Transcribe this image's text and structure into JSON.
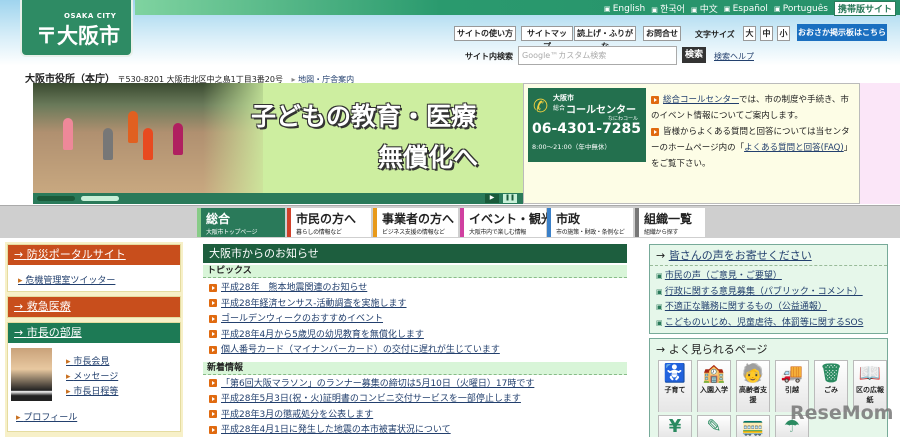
{
  "header": {
    "logo_en": "OSAKA CITY",
    "logo_jp": "大阪市",
    "languages": [
      "English",
      "한국어",
      "中文",
      "Español",
      "Português"
    ],
    "mobile": "携帯版サイト",
    "tools": [
      "サイトの使い方",
      "サイトマップ",
      "読上げ・ふりがな",
      "お問合せ"
    ],
    "font_size_label": "文字サイズ",
    "font_sizes": [
      "大",
      "中",
      "小"
    ],
    "bbs": "おおさか掲示板はこちら",
    "search_label": "サイト内検索",
    "search_placeholder": "Google™カスタム検索",
    "search_button": "検索",
    "search_help": "検索ヘルプ",
    "office": "大阪市役所（本庁）",
    "address": "〒530-8201 大阪市北区中之島1丁目3番20号",
    "map_link": "地図・庁舎案内"
  },
  "banner": {
    "line1": "子どもの教育・医療",
    "line2": "無償化へ"
  },
  "call_center": {
    "city": "大阪市",
    "name_prefix": "総合",
    "name": "コールセンター",
    "nickname": "なにわコール",
    "phone": "06-4301-7285",
    "hours": "8:00～21:00（年中無休）",
    "text1_link": "総合コールセンター",
    "text1": "では、市の制度や手続き、市のイベント情報についてご案内します。",
    "text2a": "皆様からよくある質問と回答については当センターのホームページ内の「",
    "text2_link": "よくある質問と回答(FAQ)",
    "text2b": "」をご覧下さい。"
  },
  "nav": [
    {
      "title": "総合",
      "sub": "大阪市トップページ",
      "color": "#2a7a5a"
    },
    {
      "title": "市民の方へ",
      "sub": "暮らしの情報など",
      "color": "#d0402a"
    },
    {
      "title": "事業者の方へ",
      "sub": "ビジネス支援の情報など",
      "color": "#e89a1a"
    },
    {
      "title": "イベント・観光",
      "sub": "大阪市内で楽しむ情報",
      "color": "#d040a0"
    },
    {
      "title": "市政",
      "sub": "市の施策・財政・条例など",
      "color": "#3a80c8"
    },
    {
      "title": "組織一覧",
      "sub": "組織から探す",
      "color": "#777777"
    }
  ],
  "left": {
    "disaster": "防災ポータルサイト",
    "disaster_item": "危機管理室ツイッター",
    "emergency": "救急医療",
    "mayor": "市長の部屋",
    "mayor_links": [
      "市長会見",
      "メッセージ",
      "市長日程等"
    ],
    "profile": "プロフィール"
  },
  "news": {
    "title": "大阪市からのお知らせ",
    "topics_label": "トピックス",
    "topics": [
      "平成28年　熊本地震関連のお知らせ",
      "平成28年経済センサス-活動調査を実施します",
      "ゴールデンウィークのおすすめイベント",
      "平成28年4月から5歳児の幼児教育を無償化します",
      "個人番号カード（マイナンバーカード）の交付に遅れが生じています"
    ],
    "new_label": "新着情報",
    "new": [
      "「第6回大阪マラソン」のランナー募集の締切は5月10日（火曜日）17時です",
      "平成28年5月3日(祝・火)証明書のコンビニ交付サービスを一部停止します",
      "平成28年3月の懲戒処分を公表します",
      "平成28年4月1日に発生した地震の本市被害状況について"
    ]
  },
  "right": {
    "voice_title": "皆さんの声をお寄せください",
    "voice_items": [
      "市民の声（ご意見・ご要望）",
      "行政に関する意見募集（パブリック・コメント）",
      "不適正な職務に関するもの（公益通報）",
      "こどものいじめ、児童虐待、体罰等に関するSOS"
    ],
    "popular_title": "よく見られるページ",
    "icons": [
      {
        "label": "子育て",
        "glyph": "🚼"
      },
      {
        "label": "入園入学",
        "glyph": "🏫"
      },
      {
        "label": "高齢者支援",
        "glyph": "🧓"
      },
      {
        "label": "引越",
        "glyph": "🚚"
      },
      {
        "label": "ごみ",
        "glyph": "🗑"
      },
      {
        "label": "区の広報紙",
        "glyph": "📖"
      }
    ],
    "icons_row2": [
      "¥",
      "✎",
      "🚃",
      "☂"
    ]
  },
  "watermark": "ReseMom"
}
